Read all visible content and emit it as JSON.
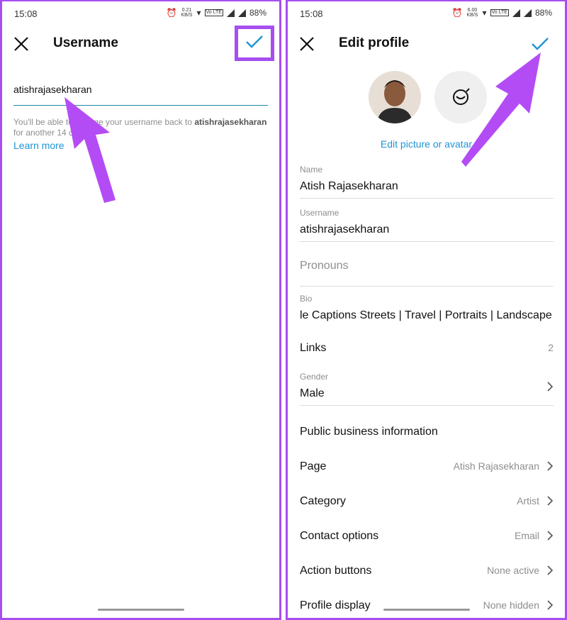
{
  "left": {
    "status": {
      "time": "15:08",
      "speed": "0.21 KB/S",
      "battery": "88%"
    },
    "header": {
      "title": "Username"
    },
    "username": {
      "value": "atishrajasekharan"
    },
    "help": {
      "prefix": "You'll be able to change your username back to ",
      "username": "atishrajasekharan",
      "suffix": " for another 14 days.",
      "link": "Learn more"
    }
  },
  "right": {
    "status": {
      "time": "15:08",
      "speed": "6.00 KB/S",
      "battery": "88%"
    },
    "header": {
      "title": "Edit profile"
    },
    "edit_picture": "Edit picture or avatar",
    "fields": {
      "name": {
        "label": "Name",
        "value": "Atish Rajasekharan"
      },
      "username": {
        "label": "Username",
        "value": "atishrajasekharan"
      },
      "pronouns": {
        "placeholder": "Pronouns"
      },
      "bio": {
        "label": "Bio",
        "value": "le Captions Streets | Travel | Portraits | Landscape"
      },
      "links": {
        "label": "Links",
        "count": "2"
      },
      "gender": {
        "label": "Gender",
        "value": "Male"
      }
    },
    "section_title": "Public business information",
    "rows": [
      {
        "label": "Page",
        "value": "Atish Rajasekharan"
      },
      {
        "label": "Category",
        "value": "Artist"
      },
      {
        "label": "Contact options",
        "value": "Email"
      },
      {
        "label": "Action buttons",
        "value": "None active"
      },
      {
        "label": "Profile display",
        "value": "None hidden"
      }
    ]
  },
  "colors": {
    "accent": "#1f95d6",
    "highlight": "#a64ef0",
    "check": "#1f95d6"
  }
}
